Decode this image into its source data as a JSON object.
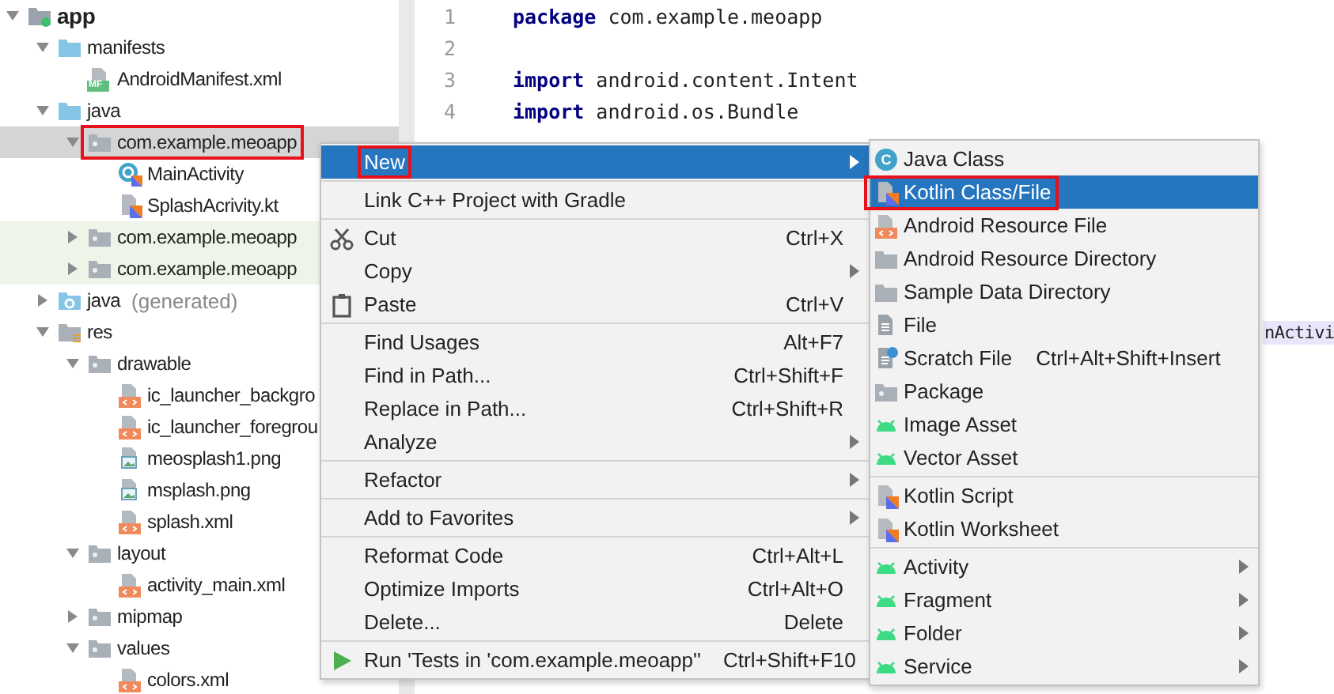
{
  "project_tree": {
    "items": [
      {
        "label": "app",
        "kind": "module",
        "bold": true,
        "expanded": true,
        "selected": false,
        "test_source": false,
        "annotated": false,
        "children": [
          {
            "label": "manifests",
            "kind": "source-folder",
            "expanded": true,
            "selected": false,
            "test_source": false,
            "annotated": false,
            "children": [
              {
                "label": "AndroidManifest.xml",
                "kind": "manifest",
                "badge": "MF",
                "selected": false,
                "test_source": false,
                "annotated": false
              }
            ]
          },
          {
            "label": "java",
            "kind": "source-folder",
            "expanded": true,
            "selected": false,
            "test_source": false,
            "annotated": false,
            "children": [
              {
                "label": "com.example.meoapp",
                "kind": "package",
                "expanded": true,
                "selected": true,
                "test_source": false,
                "annotated": true,
                "children": [
                  {
                    "label": "MainActivity",
                    "kind": "kotlin-class",
                    "selected": false,
                    "test_source": false,
                    "annotated": false
                  },
                  {
                    "label": "SplashAcrivity.kt",
                    "kind": "kotlin-file",
                    "selected": false,
                    "test_source": false,
                    "annotated": false
                  }
                ]
              },
              {
                "label": "com.example.meoapp",
                "kind": "package",
                "expanded": false,
                "selected": false,
                "test_source": true,
                "annotated": false
              },
              {
                "label": "com.example.meoapp",
                "kind": "package",
                "expanded": false,
                "selected": false,
                "test_source": true,
                "annotated": false
              }
            ]
          },
          {
            "label": "java",
            "note": "(generated)",
            "kind": "generated-folder",
            "expanded": false,
            "selected": false,
            "test_source": false,
            "annotated": false
          },
          {
            "label": "res",
            "kind": "res-folder",
            "expanded": true,
            "selected": false,
            "test_source": false,
            "annotated": false,
            "children": [
              {
                "label": "drawable",
                "kind": "package",
                "expanded": true,
                "selected": false,
                "test_source": false,
                "annotated": false,
                "children": [
                  {
                    "label": "ic_launcher_backgro",
                    "kind": "xml",
                    "selected": false,
                    "test_source": false,
                    "annotated": false
                  },
                  {
                    "label": "ic_launcher_foregrou",
                    "kind": "xml",
                    "selected": false,
                    "test_source": false,
                    "annotated": false
                  },
                  {
                    "label": "meosplash1.png",
                    "kind": "image",
                    "selected": false,
                    "test_source": false,
                    "annotated": false
                  },
                  {
                    "label": "msplash.png",
                    "kind": "image",
                    "selected": false,
                    "test_source": false,
                    "annotated": false
                  },
                  {
                    "label": "splash.xml",
                    "kind": "xml",
                    "selected": false,
                    "test_source": false,
                    "annotated": false
                  }
                ]
              },
              {
                "label": "layout",
                "kind": "package",
                "expanded": true,
                "selected": false,
                "test_source": false,
                "annotated": false,
                "children": [
                  {
                    "label": "activity_main.xml",
                    "kind": "xml",
                    "selected": false,
                    "test_source": false,
                    "annotated": false
                  }
                ]
              },
              {
                "label": "mipmap",
                "kind": "package",
                "expanded": false,
                "selected": false,
                "test_source": false,
                "annotated": false
              },
              {
                "label": "values",
                "kind": "package",
                "expanded": true,
                "selected": false,
                "test_source": false,
                "annotated": false,
                "children": [
                  {
                    "label": "colors.xml",
                    "kind": "xml",
                    "selected": false,
                    "test_source": false,
                    "annotated": false
                  }
                ]
              }
            ]
          }
        ]
      }
    ]
  },
  "editor": {
    "lines": [
      {
        "number": "1",
        "code": "**package** com.example.meoapp"
      },
      {
        "number": "2"
      },
      {
        "number": "3",
        "code": "**import** android.content.Intent"
      },
      {
        "number": "4",
        "code": "**import** android.os.Bundle"
      }
    ],
    "highlighted_fragment": "nActivi"
  },
  "context_menu": {
    "items": [
      {
        "kind": "plain",
        "label": "New",
        "has_submenu": true,
        "selected": true,
        "annotated": true
      },
      {
        "kind": "separator"
      },
      {
        "kind": "plain",
        "label": "Link C++ Project with Gradle",
        "has_submenu": false,
        "selected": false,
        "annotated": false
      },
      {
        "kind": "separator"
      },
      {
        "kind": "scissors",
        "label": "Cut",
        "shortcut": "Ctrl+X",
        "has_submenu": false,
        "selected": false,
        "annotated": false
      },
      {
        "kind": "plain",
        "label": "Copy",
        "has_submenu": true,
        "selected": false,
        "annotated": false
      },
      {
        "kind": "clipboard",
        "label": "Paste",
        "shortcut": "Ctrl+V",
        "has_submenu": false,
        "selected": false,
        "annotated": false
      },
      {
        "kind": "separator"
      },
      {
        "kind": "plain",
        "label": "Find Usages",
        "shortcut": "Alt+F7",
        "has_submenu": false,
        "selected": false,
        "annotated": false
      },
      {
        "kind": "plain",
        "label": "Find in Path...",
        "shortcut": "Ctrl+Shift+F",
        "has_submenu": false,
        "selected": false,
        "annotated": false
      },
      {
        "kind": "plain",
        "label": "Replace in Path...",
        "shortcut": "Ctrl+Shift+R",
        "has_submenu": false,
        "selected": false,
        "annotated": false
      },
      {
        "kind": "plain",
        "label": "Analyze",
        "has_submenu": true,
        "selected": false,
        "annotated": false
      },
      {
        "kind": "separator"
      },
      {
        "kind": "plain",
        "label": "Refactor",
        "has_submenu": true,
        "selected": false,
        "annotated": false
      },
      {
        "kind": "separator"
      },
      {
        "kind": "plain",
        "label": "Add to Favorites",
        "has_submenu": true,
        "selected": false,
        "annotated": false
      },
      {
        "kind": "separator"
      },
      {
        "kind": "plain",
        "label": "Reformat Code",
        "shortcut": "Ctrl+Alt+L",
        "has_submenu": false,
        "selected": false,
        "annotated": false
      },
      {
        "kind": "plain",
        "label": "Optimize Imports",
        "shortcut": "Ctrl+Alt+O",
        "has_submenu": false,
        "selected": false,
        "annotated": false
      },
      {
        "kind": "plain",
        "label": "Delete...",
        "shortcut": "Delete",
        "has_submenu": false,
        "selected": false,
        "annotated": false
      },
      {
        "kind": "separator"
      },
      {
        "kind": "run",
        "label": "Run 'Tests in 'com.example.meoapp''",
        "shortcut": "Ctrl+Shift+F10",
        "has_submenu": false,
        "selected": false,
        "annotated": false
      }
    ]
  },
  "new_submenu": {
    "items": [
      {
        "kind": "java-class",
        "badge": "C",
        "label": "Java Class",
        "has_submenu": false,
        "selected": false,
        "annotated": false
      },
      {
        "kind": "kotlin",
        "label": "Kotlin Class/File",
        "has_submenu": false,
        "selected": true,
        "annotated": true
      },
      {
        "kind": "xml",
        "label": "Android Resource File",
        "has_submenu": false,
        "selected": false,
        "annotated": false
      },
      {
        "kind": "folder",
        "label": "Android Resource Directory",
        "has_submenu": false,
        "selected": false,
        "annotated": false
      },
      {
        "kind": "folder",
        "label": "Sample Data Directory",
        "has_submenu": false,
        "selected": false,
        "annotated": false
      },
      {
        "kind": "file",
        "label": "File",
        "has_submenu": false,
        "selected": false,
        "annotated": false
      },
      {
        "kind": "scratch",
        "label": "Scratch File",
        "shortcut": "Ctrl+Alt+Shift+Insert",
        "has_submenu": false,
        "selected": false,
        "annotated": false
      },
      {
        "kind": "package",
        "label": "Package",
        "has_submenu": false,
        "selected": false,
        "annotated": false
      },
      {
        "kind": "android",
        "label": "Image Asset",
        "has_submenu": false,
        "selected": false,
        "annotated": false
      },
      {
        "kind": "android",
        "label": "Vector Asset",
        "has_submenu": false,
        "selected": false,
        "annotated": false
      },
      {
        "kind": "separator"
      },
      {
        "kind": "kotlin",
        "label": "Kotlin Script",
        "has_submenu": false,
        "selected": false,
        "annotated": false
      },
      {
        "kind": "kotlin",
        "label": "Kotlin Worksheet",
        "has_submenu": false,
        "selected": false,
        "annotated": false
      },
      {
        "kind": "separator"
      },
      {
        "kind": "android",
        "label": "Activity",
        "has_submenu": true,
        "selected": false,
        "annotated": false
      },
      {
        "kind": "android",
        "label": "Fragment",
        "has_submenu": true,
        "selected": false,
        "annotated": false
      },
      {
        "kind": "android",
        "label": "Folder",
        "has_submenu": true,
        "selected": false,
        "annotated": false
      },
      {
        "kind": "android",
        "label": "Service",
        "has_submenu": true,
        "selected": false,
        "annotated": false
      }
    ]
  }
}
